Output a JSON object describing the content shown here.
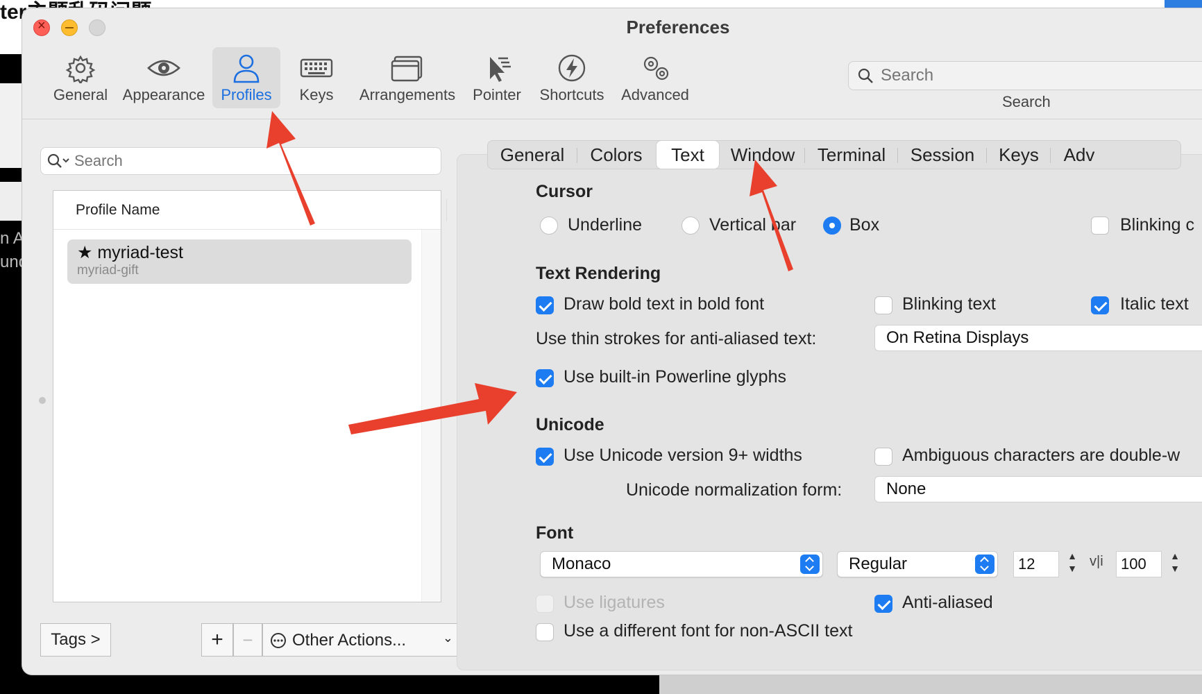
{
  "background": {
    "title_fragment": "ter主题乱码问题",
    "left_text_1": "n A",
    "left_text_2": "und"
  },
  "window": {
    "title": "Preferences"
  },
  "toolbar": {
    "items": [
      {
        "label": "General",
        "icon": "gear-icon"
      },
      {
        "label": "Appearance",
        "icon": "eye-icon"
      },
      {
        "label": "Profiles",
        "icon": "person-icon",
        "active": true
      },
      {
        "label": "Keys",
        "icon": "keyboard-icon"
      },
      {
        "label": "Arrangements",
        "icon": "window-icon"
      },
      {
        "label": "Pointer",
        "icon": "pointer-icon"
      },
      {
        "label": "Shortcuts",
        "icon": "bolt-icon"
      },
      {
        "label": "Advanced",
        "icon": "gears-icon"
      }
    ],
    "search_placeholder": "Search",
    "search_label": "Search"
  },
  "profiles": {
    "search_placeholder": "Search",
    "column_header": "Profile Name",
    "rows": [
      {
        "name": "★ myriad-test",
        "subtitle": "myriad-gift"
      }
    ],
    "tags_button": "Tags >",
    "add_button": "+",
    "remove_button": "−",
    "other_actions": "Other Actions..."
  },
  "tabs": [
    "General",
    "Colors",
    "Text",
    "Window",
    "Terminal",
    "Session",
    "Keys",
    "Adv"
  ],
  "active_tab": "Text",
  "cursor": {
    "heading": "Cursor",
    "underline": "Underline",
    "vertical_bar": "Vertical bar",
    "box": "Box",
    "selected": "Box",
    "blinking": "Blinking c"
  },
  "text_rendering": {
    "heading": "Text Rendering",
    "draw_bold": "Draw bold text in bold font",
    "draw_bold_checked": true,
    "blinking_text": "Blinking text",
    "blinking_text_checked": false,
    "italic_text": "Italic text",
    "italic_text_checked": true,
    "thin_strokes_label": "Use thin strokes for anti-aliased text:",
    "thin_strokes_value": "On Retina Displays",
    "powerline": "Use built-in Powerline glyphs",
    "powerline_checked": true
  },
  "unicode": {
    "heading": "Unicode",
    "version9": "Use Unicode version 9+ widths",
    "version9_checked": true,
    "ambiguous": "Ambiguous characters are double-w",
    "ambiguous_checked": false,
    "normalization_label": "Unicode normalization form:",
    "normalization_value": "None"
  },
  "font": {
    "heading": "Font",
    "family": "Monaco",
    "style": "Regular",
    "size": "12",
    "vli_label": "v|i",
    "spacing": "100",
    "ligatures": "Use ligatures",
    "ligatures_checked": false,
    "anti_aliased": "Anti-aliased",
    "anti_aliased_checked": true,
    "non_ascii": "Use a different font for non-ASCII text",
    "non_ascii_checked": false
  },
  "colors": {
    "accent": "#1e7cf2",
    "annotation_arrow": "#e8402d"
  }
}
